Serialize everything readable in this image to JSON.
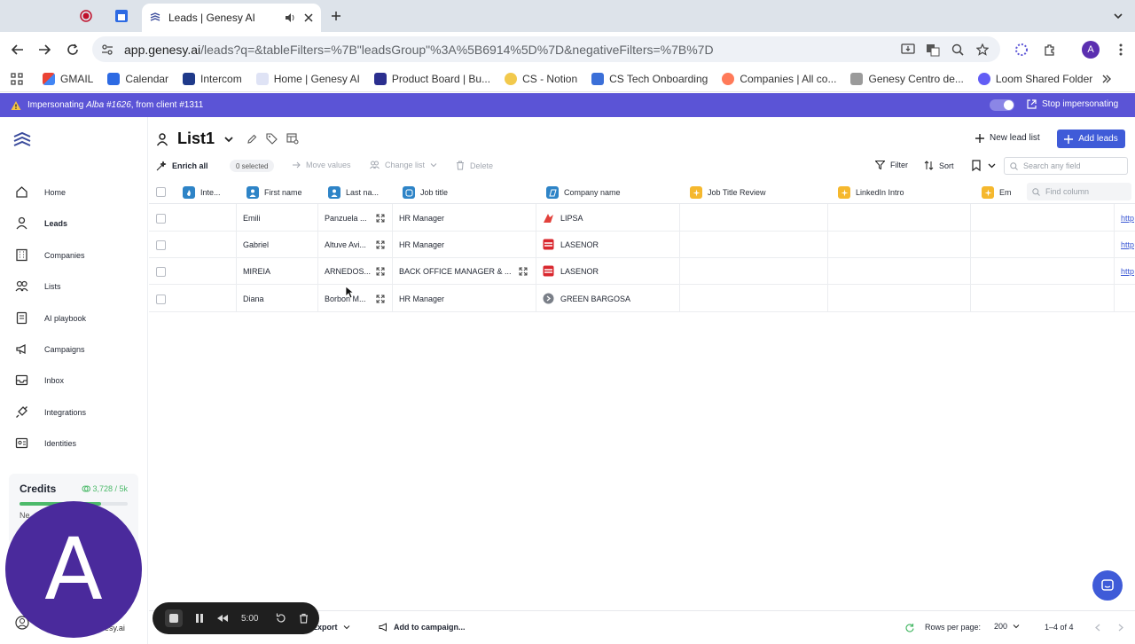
{
  "browser": {
    "tab_title": "Leads | Genesy AI",
    "url_host": "app.genesy.ai",
    "url_path": "/leads?q=&tableFilters=%7B\"leadsGroup\"%3A%5B6914%5D%7D&negativeFilters=%7B%7D",
    "profile_initial": "A",
    "bookmarks": [
      "GMAIL",
      "Calendar",
      "Intercom",
      "Home | Genesy AI",
      "Product Board | Bu...",
      "CS - Notion",
      "CS Tech Onboarding",
      "Companies | All co...",
      "Genesy Centro de...",
      "Loom Shared Folder"
    ]
  },
  "impersonation": {
    "text_prefix": "Impersonating ",
    "user": "Alba #1626",
    "text_suffix": ", from client #1311",
    "stop_label": "Stop impersonating"
  },
  "sidebar": {
    "items": [
      {
        "label": "Home"
      },
      {
        "label": "Leads"
      },
      {
        "label": "Companies"
      },
      {
        "label": "Lists"
      },
      {
        "label": "AI playbook"
      },
      {
        "label": "Campaigns"
      },
      {
        "label": "Inbox"
      },
      {
        "label": "Integrations"
      },
      {
        "label": "Identities"
      }
    ],
    "credits": {
      "label": "Credits",
      "value": "3,728 / 5k",
      "sub": "Ne",
      "fill_fraction": 0.75
    },
    "brand_fragment": "esy.ai"
  },
  "header": {
    "list_name": "List1",
    "new_lead_list": "New lead list",
    "add_leads": "Add leads"
  },
  "actions": {
    "enrich_all": "Enrich all",
    "selected": "0 selected",
    "move_values": "Move values",
    "change_list": "Change list",
    "delete": "Delete",
    "filter": "Filter",
    "sort": "Sort",
    "search_placeholder": "Search any field",
    "find_column_placeholder": "Find column"
  },
  "table": {
    "columns": [
      "Inte...",
      "First name",
      "Last na...",
      "Job title",
      "Company name",
      "Job Title Review",
      "LinkedIn Intro",
      "Em"
    ],
    "rows": [
      {
        "first": "Emili",
        "last": "Panzuela ...",
        "job": "HR Manager",
        "company": "LIPSA",
        "link": "http"
      },
      {
        "first": "Gabriel",
        "last": "Altuve Avi...",
        "job": "HR Manager",
        "company": "LASENOR",
        "link": "http"
      },
      {
        "first": "MIREIA",
        "last": "ARNEDOS...",
        "job": "BACK OFFICE MANAGER & ...",
        "company": "LASENOR",
        "link": "http"
      },
      {
        "first": "Diana",
        "last": "Borbon M...",
        "job": "HR Manager",
        "company": "GREEN BARGOSA",
        "link": ""
      }
    ]
  },
  "footer": {
    "export": "Export",
    "add_to_campaign": "Add to campaign...",
    "rows_per_page_label": "Rows per page:",
    "rows_per_page": "200",
    "range": "1–4 of 4"
  },
  "recorder": {
    "time": "5:00"
  },
  "overlay_avatar": "A",
  "colors": {
    "accent": "#3f5bd8",
    "banner": "#5b54d6",
    "avatar": "#4a2a9c",
    "credits_green": "#4cba6a"
  }
}
